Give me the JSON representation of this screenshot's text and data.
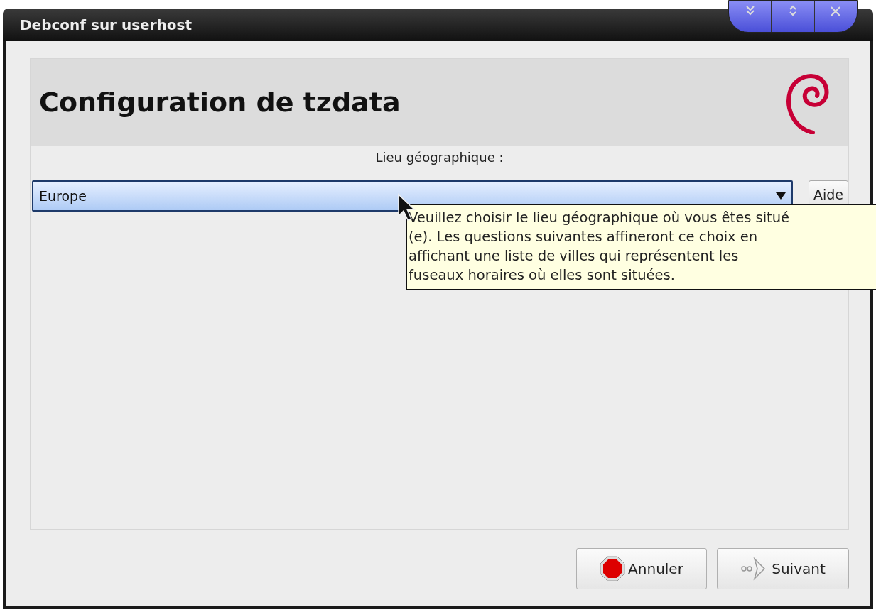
{
  "window": {
    "title": "Debconf sur userhost"
  },
  "header": {
    "title": "Configuration de tzdata"
  },
  "question": {
    "label": "Lieu géographique :",
    "value": "Europe"
  },
  "help_button": "Aide",
  "tooltip": {
    "lines": [
      "Veuillez choisir le lieu géographique où vous êtes situé",
      "(e). Les questions suivantes affineront ce choix en",
      "affichant une liste de villes qui représentent les",
      "fuseaux horaires où elles sont situées."
    ]
  },
  "buttons": [
    {
      "label": "Annuler",
      "kind": "cancel"
    },
    {
      "label": "Suivant",
      "kind": "next"
    }
  ]
}
